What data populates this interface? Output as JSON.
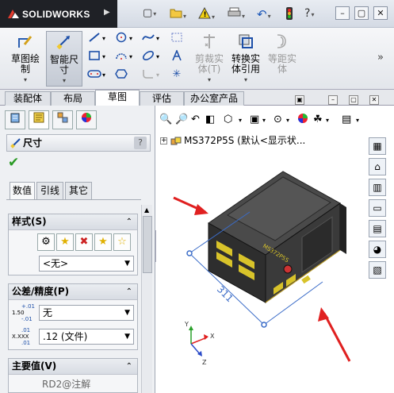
{
  "app": {
    "logo_text": "SOLIDWORKS"
  },
  "quick_access": [
    "new-icon",
    "open-icon",
    "rebuild-icon",
    "print-icon",
    "undo-icon",
    "traffic-light-icon",
    "help-icon"
  ],
  "ribbon": {
    "sketch": "草图绘\n制",
    "smart_dimension": "智能尺\n寸",
    "trim": "剪裁实\n体(T)",
    "convert": "转换实\n体引用",
    "offset": "等距实\n体"
  },
  "tabs": [
    {
      "label": "装配体",
      "active": false
    },
    {
      "label": "布局",
      "active": false
    },
    {
      "label": "草图",
      "active": true
    },
    {
      "label": "评估",
      "active": false
    },
    {
      "label": "办公室产品",
      "active": false
    }
  ],
  "property_manager": {
    "title": "尺寸",
    "help": "?",
    "subtabs": [
      "数值",
      "引线",
      "其它"
    ],
    "style_group": {
      "header": "样式(S)",
      "combo_value": "<无>"
    },
    "tolerance_group": {
      "header": "公差/精度(P)",
      "tolerance_value": "无",
      "precision_value": ".12 (文件)",
      "tol_icon_top": "+.01",
      "tol_icon_mid": "1.50",
      "tol_icon_bot": "-.01",
      "prec_icon_top": ".01",
      "prec_icon_mid": "X.XXX",
      "prec_icon_bot": ".01"
    },
    "primary_group": {
      "header": "主要值(V)",
      "value": "RD2@注解"
    }
  },
  "graphics": {
    "tree_root": "MS372P5S  (默认<显示状...",
    "dimension_value": "311",
    "triad": {
      "x": "X",
      "y": "Y",
      "z": "Z"
    }
  },
  "colors": {
    "arrow": "#e02020",
    "dimension": "#3b6cc8",
    "part_body": "#3a3a3a",
    "part_stripe": "#d8c32a"
  }
}
